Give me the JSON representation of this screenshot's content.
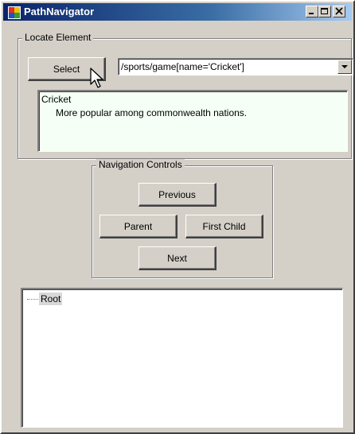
{
  "window": {
    "title": "PathNavigator",
    "controls": {
      "minimize": "minimize",
      "maximize": "maximize",
      "close": "close"
    }
  },
  "locate": {
    "legend": "Locate Element",
    "select_label": "Select",
    "xpath_value": "/sports/game[name='Cricket']",
    "result_title": "Cricket",
    "result_desc": "More popular among commonwealth nations."
  },
  "nav": {
    "legend": "Navigation Controls",
    "previous": "Previous",
    "parent": "Parent",
    "first_child": "First Child",
    "next": "Next"
  },
  "tree": {
    "root_label": "Root"
  }
}
